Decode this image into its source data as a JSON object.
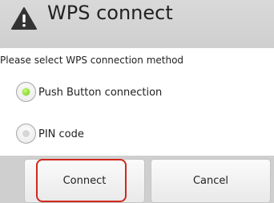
{
  "dialog": {
    "title": "WPS connect",
    "title_icon": "warning-icon",
    "prompt": "Please select WPS connection method",
    "options": [
      {
        "label": "Push Button connection",
        "selected": true
      },
      {
        "label": "PIN code",
        "selected": false
      }
    ],
    "buttons": {
      "connect": "Connect",
      "cancel": "Cancel"
    }
  },
  "colors": {
    "highlight": "#d0281c",
    "radio_selected": "#6cc21a",
    "title_bar": "#d3d3d3"
  }
}
